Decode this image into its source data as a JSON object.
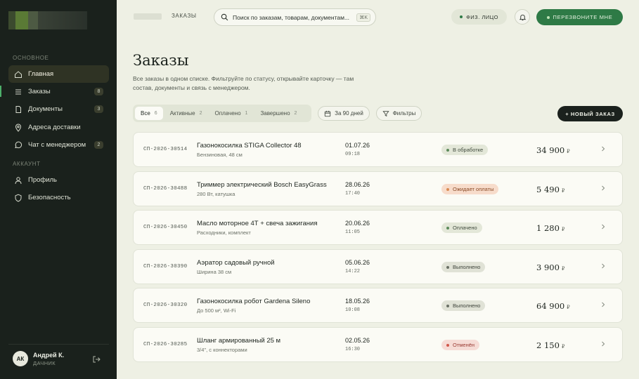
{
  "sidebar": {
    "section_main": "ОСНОВНОЕ",
    "section_account": "АККАУНТ",
    "items": [
      {
        "label": "Главная",
        "icon": "home-icon"
      },
      {
        "label": "Заказы",
        "icon": "orders-icon",
        "count": "8"
      },
      {
        "label": "Документы",
        "icon": "document-icon",
        "count": "3"
      },
      {
        "label": "Адреса доставки",
        "icon": "location-pin-icon"
      },
      {
        "label": "Чат с менеджером",
        "icon": "chat-icon",
        "count": "2"
      },
      {
        "label": "Профиль",
        "icon": "user-icon"
      },
      {
        "label": "Безопасность",
        "icon": "shield-icon"
      }
    ],
    "user": {
      "initials": "АК",
      "name": "Андрей К.",
      "role": "ДАЧНИК"
    }
  },
  "topbar": {
    "breadcrumb": "ЗАКАЗЫ",
    "search_placeholder": "Поиск по заказам, товарам, документам...",
    "search_shortcut": "⌘K",
    "account_type": "ФИЗ. ЛИЦО",
    "callback_label": "ПЕРЕЗВОНИТЕ МНЕ"
  },
  "main": {
    "title": "Заказы",
    "description": "Все заказы в одном списке. Фильтруйте по статусу, открывайте карточку — там состав, документы и связь с менеджером.",
    "tabs": [
      {
        "label": "Все",
        "count": "6"
      },
      {
        "label": "Активные",
        "count": "2"
      },
      {
        "label": "Оплачено",
        "count": "1"
      },
      {
        "label": "Завершено",
        "count": "2"
      }
    ],
    "period_label": "За 90 дней",
    "filters_label": "Фильтры",
    "new_order_label": "+ НОВЫЙ ЗАКАЗ"
  },
  "orders": [
    {
      "id": "СП-2026-30514",
      "name": "Газонокосилка STIGA Collector 48",
      "sub": "Бензиновая, 48 см",
      "date": "01.07.26",
      "time": "09:18",
      "status": "В обработке",
      "status_kind": "neutral",
      "price": "34 900",
      "currency": "₽"
    },
    {
      "id": "СП-2026-30488",
      "name": "Триммер электрический Bosch EasyGrass",
      "sub": "280 Вт, катушка",
      "date": "28.06.26",
      "time": "17:40",
      "status": "Ожидает оплаты",
      "status_kind": "warning",
      "price": "5 490",
      "currency": "₽"
    },
    {
      "id": "СП-2026-30450",
      "name": "Масло моторное 4Т + свеча зажигания",
      "sub": "Расходники, комплект",
      "date": "20.06.26",
      "time": "11:05",
      "status": "Оплачено",
      "status_kind": "neutral",
      "price": "1 280",
      "currency": "₽"
    },
    {
      "id": "СП-2026-30390",
      "name": "Аэратор садовый ручной",
      "sub": "Ширина 38 см",
      "date": "05.06.26",
      "time": "14:22",
      "status": "Выполнено",
      "status_kind": "done",
      "price": "3 900",
      "currency": "₽"
    },
    {
      "id": "СП-2026-30320",
      "name": "Газонокосилка робот Gardena Sileno",
      "sub": "До 500 м², Wi-Fi",
      "date": "18.05.26",
      "time": "10:08",
      "status": "Выполнено",
      "status_kind": "done",
      "price": "64 900",
      "currency": "₽"
    },
    {
      "id": "СП-2026-30285",
      "name": "Шланг армированный 25 м",
      "sub": "3/4\", с коннекторами",
      "date": "02.05.26",
      "time": "16:30",
      "status": "Отменён",
      "status_kind": "cancelled",
      "price": "2 150",
      "currency": "₽"
    }
  ],
  "colors": {
    "sidebar_bg": "#1a211c",
    "page_bg": "#eef0e4",
    "accent_green": "#2e7a46",
    "status_neutral_bg": "#e3e7d8",
    "status_warning_bg": "#f7dccb",
    "status_done_bg": "#e0e2d6",
    "status_cancelled_bg": "#f6dcd6"
  }
}
